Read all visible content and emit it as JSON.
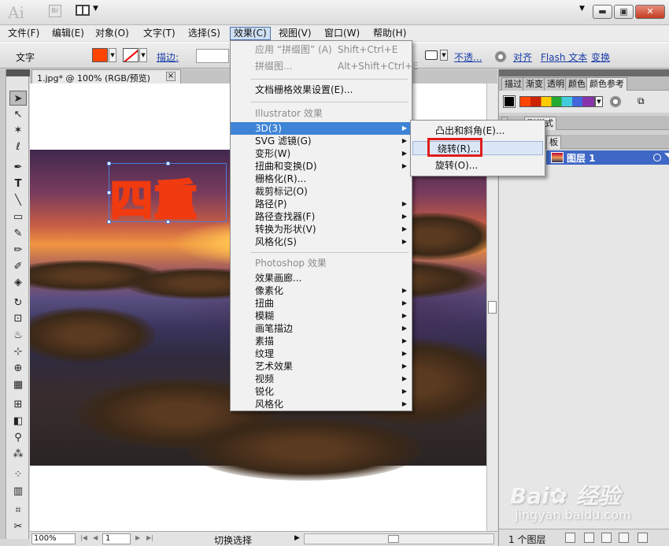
{
  "titlebar": {
    "app_logo": "Ai",
    "bridge_label": "Br",
    "min": "▬",
    "max": "▣",
    "close": "✕"
  },
  "menubar": [
    {
      "label": "文件(F)"
    },
    {
      "label": "编辑(E)"
    },
    {
      "label": "对象(O)"
    },
    {
      "label": "文字(T)"
    },
    {
      "label": "选择(S)"
    },
    {
      "label": "效果(C)"
    },
    {
      "label": "视图(V)"
    },
    {
      "label": "窗口(W)"
    },
    {
      "label": "帮助(H)"
    }
  ],
  "controlbar": {
    "tool_label": "文字",
    "fill_color": "#ff4500",
    "stroke_label": "描边:",
    "opacity_label": "不透...",
    "align_label": "对齐",
    "flash_text_label": "Flash 文本",
    "transform_label": "变换"
  },
  "document": {
    "tab_title": "1.jpg* @ 100% (RGB/预览)",
    "close": "×",
    "text_object": "四重"
  },
  "statusbar": {
    "zoom": "100%",
    "page": "1",
    "status_text": "切换选择"
  },
  "effect_menu": {
    "items": [
      {
        "label": "应用 “拼缀图” (A)",
        "shortcut": "Shift+Ctrl+E",
        "disabled": true
      },
      {
        "label": "拼缀图...",
        "shortcut": "Alt+Shift+Ctrl+E",
        "disabled": true
      },
      {
        "label": "文档栅格效果设置(E)..."
      },
      {
        "label": "Illustrator 效果",
        "section": true
      },
      {
        "label": "3D(3)",
        "submenu": true,
        "highlighted": true
      },
      {
        "label": "SVG 滤镜(G)",
        "submenu": true
      },
      {
        "label": "变形(W)",
        "submenu": true
      },
      {
        "label": "扭曲和变换(D)",
        "submenu": true
      },
      {
        "label": "栅格化(R)..."
      },
      {
        "label": "裁剪标记(O)"
      },
      {
        "label": "路径(P)",
        "submenu": true
      },
      {
        "label": "路径查找器(F)",
        "submenu": true
      },
      {
        "label": "转换为形状(V)",
        "submenu": true
      },
      {
        "label": "风格化(S)",
        "submenu": true
      },
      {
        "label": "Photoshop 效果",
        "section": true
      },
      {
        "label": "效果画廊..."
      },
      {
        "label": "像素化",
        "submenu": true
      },
      {
        "label": "扭曲",
        "submenu": true
      },
      {
        "label": "模糊",
        "submenu": true
      },
      {
        "label": "画笔描边",
        "submenu": true
      },
      {
        "label": "素描",
        "submenu": true
      },
      {
        "label": "纹理",
        "submenu": true
      },
      {
        "label": "艺术效果",
        "submenu": true
      },
      {
        "label": "视频",
        "submenu": true
      },
      {
        "label": "锐化",
        "submenu": true
      },
      {
        "label": "风格化",
        "submenu": true
      }
    ]
  },
  "submenu_3d": {
    "items": [
      {
        "label": "凸出和斜角(E)..."
      },
      {
        "label": "绕转(R)...",
        "highlighted": true
      },
      {
        "label": "旋转(O)..."
      }
    ]
  },
  "panels": {
    "top_tabs": [
      "描过",
      "渐变",
      "透明",
      "颜色",
      "颜色参考"
    ],
    "mid_tabs": [
      "",
      "形样式"
    ],
    "layers_tab": "板",
    "swatch_colors": [
      "#000000",
      "#ff4500",
      "#ffcc00",
      "#22aa33",
      "#44ccdd",
      "#4466dd",
      "#8833aa"
    ],
    "layer_name": "图层 1",
    "layer_count": "1 个图层"
  },
  "watermark": {
    "logo": "Bai",
    "logo2": "经验",
    "sub": "jingyan.baidu.com"
  }
}
